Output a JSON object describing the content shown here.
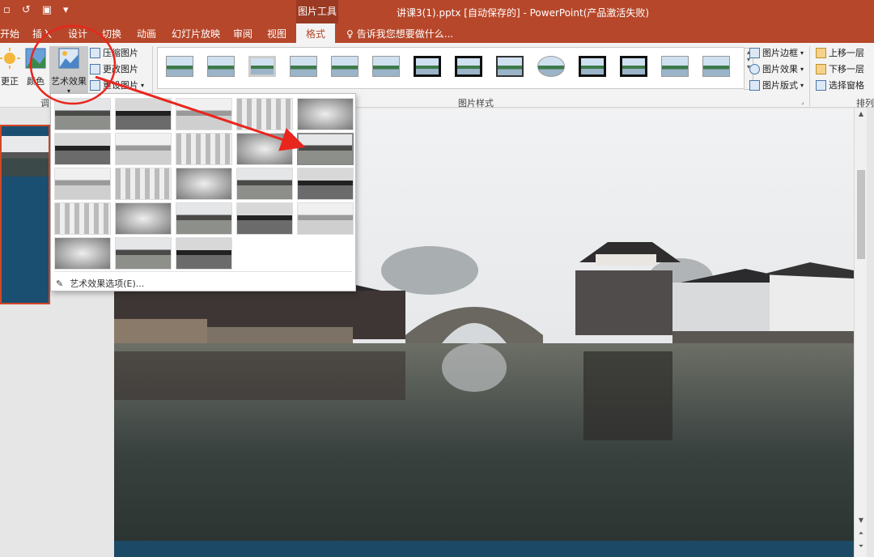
{
  "window": {
    "title": "讲课3(1).pptx [自动保存的] - PowerPoint(产品激活失败)",
    "context_tool": "图片工具"
  },
  "tabs": [
    "开始",
    "插入",
    "设计",
    "切换",
    "动画",
    "幻灯片放映",
    "审阅",
    "视图",
    "格式"
  ],
  "active_tab": "格式",
  "tellme": "告诉我您想要做什么...",
  "ribbon": {
    "adjust": {
      "corrections": "更正",
      "color": "颜色",
      "artistic": "艺术效果",
      "compress": "压缩图片",
      "change": "更改图片",
      "reset": "重设图片",
      "group_label": "调"
    },
    "styles": {
      "group_label": "图片样式"
    },
    "picture_cmds": {
      "border": "图片边框",
      "effects": "图片效果",
      "layout": "图片版式"
    },
    "arrange": {
      "bring_forward": "上移一层",
      "send_backward": "下移一层",
      "selection_pane": "选择窗格",
      "group_label": "排列"
    }
  },
  "artistic_menu": {
    "options_label": "艺术效果选项(E)...",
    "rows": [
      5,
      5,
      5,
      5,
      3
    ],
    "selected": {
      "row": 1,
      "col": 4
    }
  },
  "colors": {
    "accent": "#b7472a",
    "annotation": "#e8261d"
  }
}
